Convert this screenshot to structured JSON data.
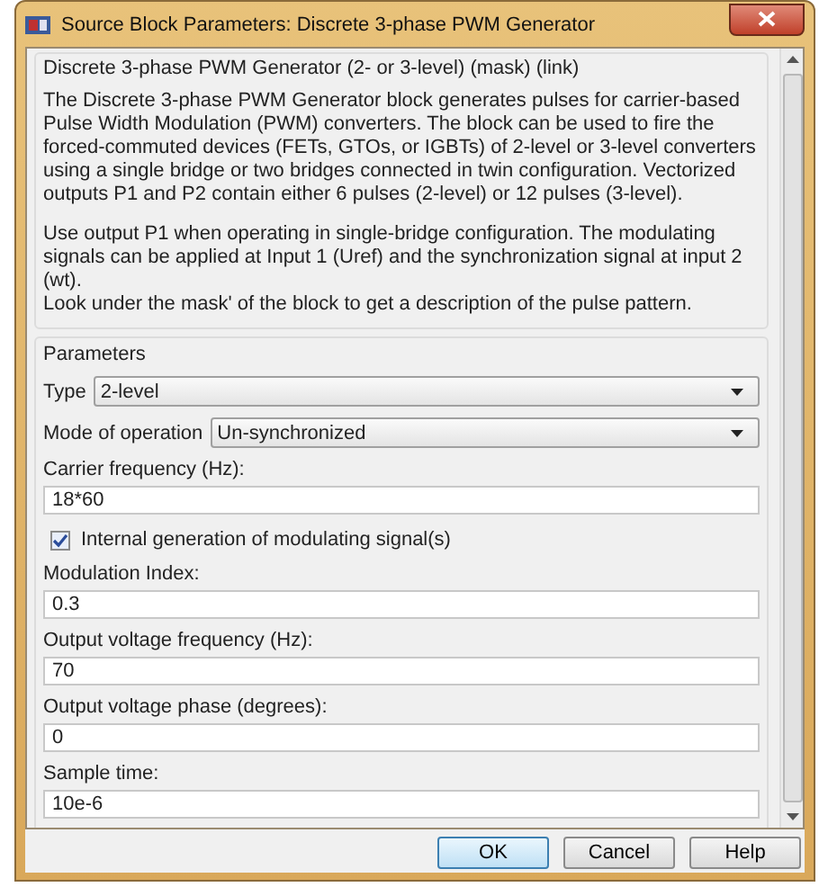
{
  "window": {
    "title": "Source Block Parameters: Discrete 3-phase PWM Generator"
  },
  "description": {
    "heading": "Discrete 3-phase PWM Generator (2- or 3-level) (mask) (link)",
    "paragraphs": [
      "The Discrete 3-phase PWM Generator block generates pulses for carrier-based Pulse Width Modulation (PWM) converters. The block can be used to fire the forced-commuted devices (FETs, GTOs, or IGBTs) of 2-level or 3-level converters using a single  bridge or two bridges connected in twin configuration. Vectorized outputs P1 and P2 contain  either 6 pulses (2-level) or 12 pulses (3-level).",
      "Use output P1 when operating in single-bridge configuration. The modulating signals can be applied at Input 1 (Uref) and the synchronization signal at input 2 (wt).\nLook under the mask' of the block to get a description of the pulse pattern."
    ]
  },
  "parameters": {
    "title": "Parameters",
    "fields": [
      {
        "kind": "dropdown",
        "label": "Type",
        "value": "2-level"
      },
      {
        "kind": "dropdown",
        "label": "Mode of operation",
        "value": "Un-synchronized"
      },
      {
        "kind": "text",
        "label": "Carrier frequency (Hz):",
        "value": "18*60"
      },
      {
        "kind": "checkbox",
        "label": "Internal generation of modulating signal(s)",
        "checked": true
      },
      {
        "kind": "text",
        "label": "Modulation Index:",
        "value": "0.3"
      },
      {
        "kind": "text",
        "label": "Output voltage frequency (Hz):",
        "value": "70"
      },
      {
        "kind": "text",
        "label": "Output voltage phase (degrees):",
        "value": "0"
      },
      {
        "kind": "text",
        "label": "Sample time:",
        "value": "10e-6"
      }
    ]
  },
  "buttons": [
    {
      "label": "OK",
      "default": true
    },
    {
      "label": "Cancel",
      "default": false
    },
    {
      "label": "Help",
      "default": false
    }
  ]
}
